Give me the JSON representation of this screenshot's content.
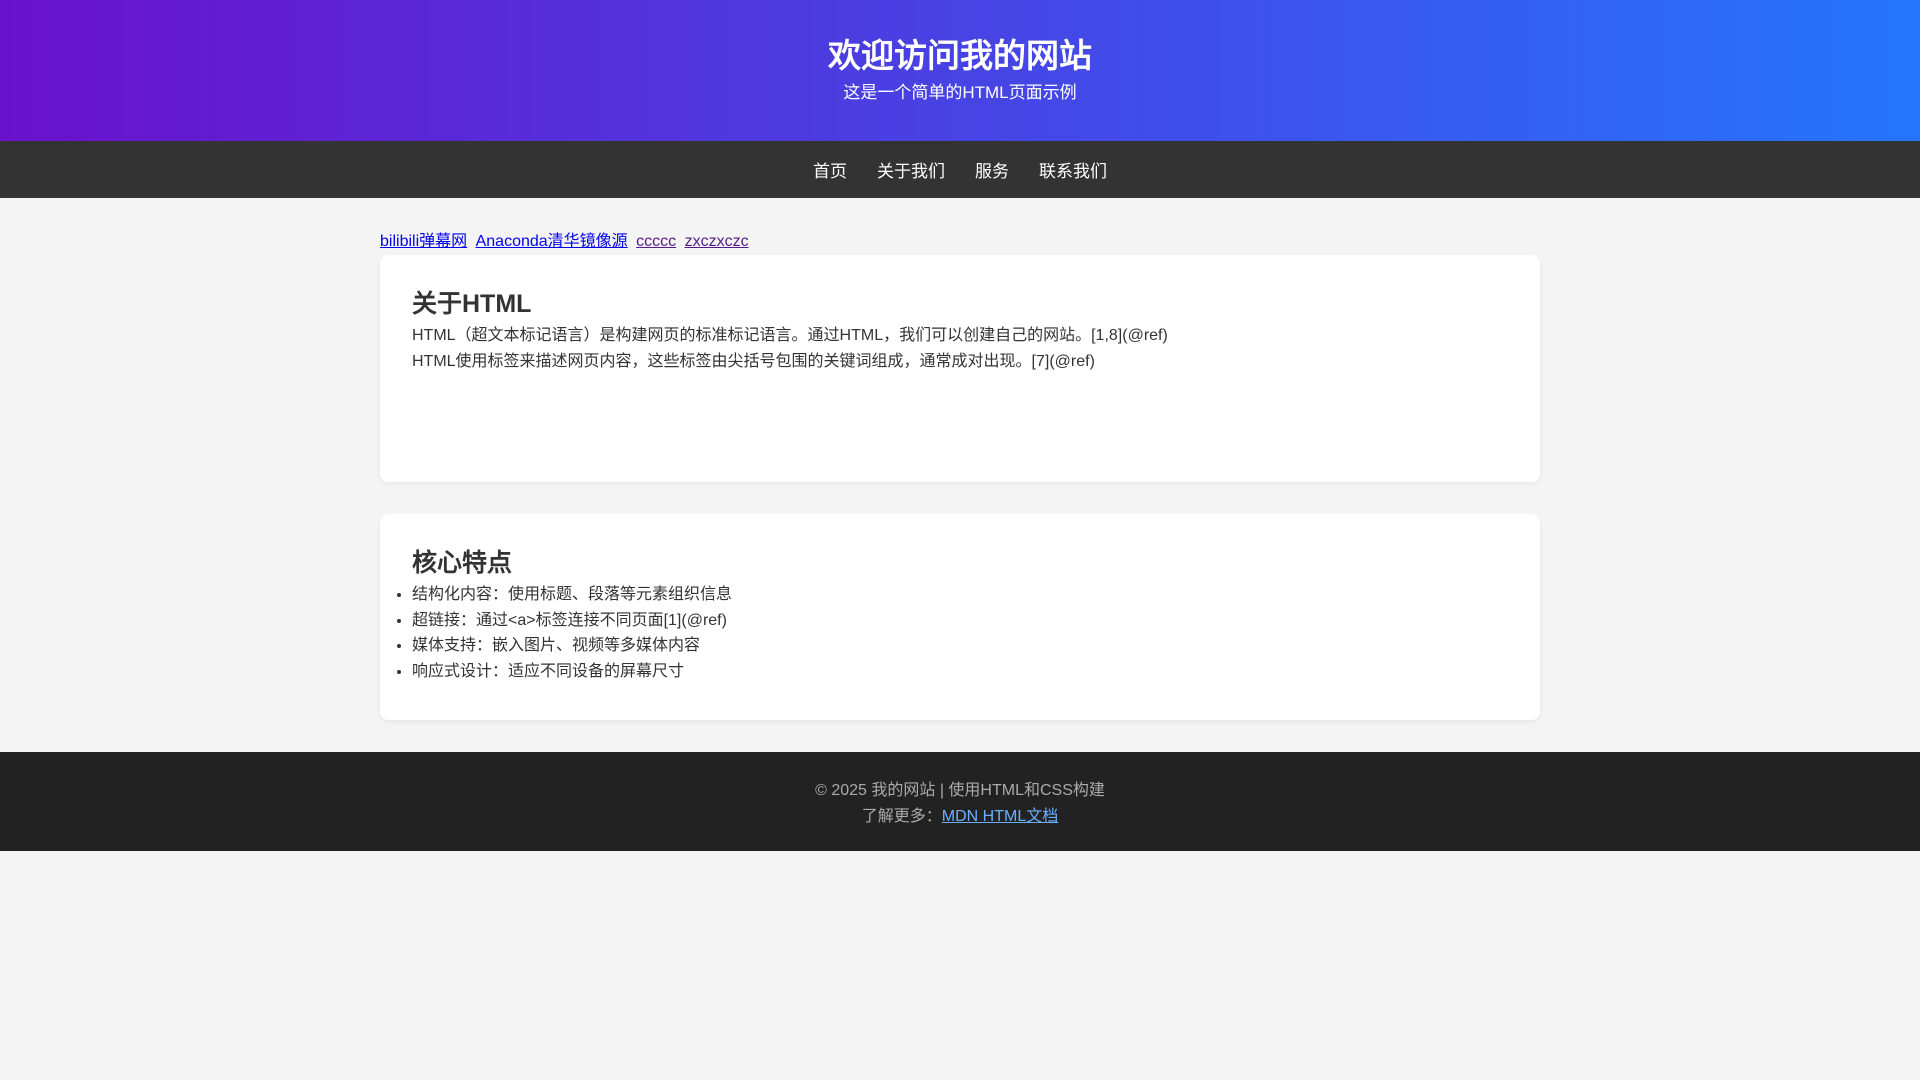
{
  "header": {
    "title": "欢迎访问我的网站",
    "subtitle": "这是一个简单的HTML页面示例"
  },
  "nav": {
    "items": [
      "首页",
      "关于我们",
      "服务",
      "联系我们"
    ]
  },
  "links": [
    {
      "label": "bilibili弹幕网"
    },
    {
      "label": "Anaconda清华镜像源"
    },
    {
      "label": "ccccc"
    },
    {
      "label": "zxczxczc"
    }
  ],
  "about": {
    "title": "关于HTML",
    "paragraphs": [
      "HTML（超文本标记语言）是构建网页的标准标记语言。通过HTML，我们可以创建自己的网站。[1,8](@ref)",
      "HTML使用标签来描述网页内容，这些标签由尖括号包围的关键词组成，通常成对出现。[7](@ref)"
    ]
  },
  "features": {
    "title": "核心特点",
    "items": [
      "结构化内容：使用标题、段落等元素组织信息",
      "超链接：通过<a>标签连接不同页面[1](@ref)",
      "媒体支持：嵌入图片、视频等多媒体内容",
      "响应式设计：适应不同设备的屏幕尺寸"
    ]
  },
  "footer": {
    "copyright": "© 2025 我的网站 | 使用HTML和CSS构建",
    "learn_more_prefix": "了解更多：",
    "learn_more_link": "MDN HTML文档"
  },
  "colors": {
    "gradient_start": "#6a11cb",
    "gradient_end": "#2575fc",
    "nav_bg": "#333333",
    "footer_bg": "#222222",
    "page_bg": "#f4f4f4"
  }
}
